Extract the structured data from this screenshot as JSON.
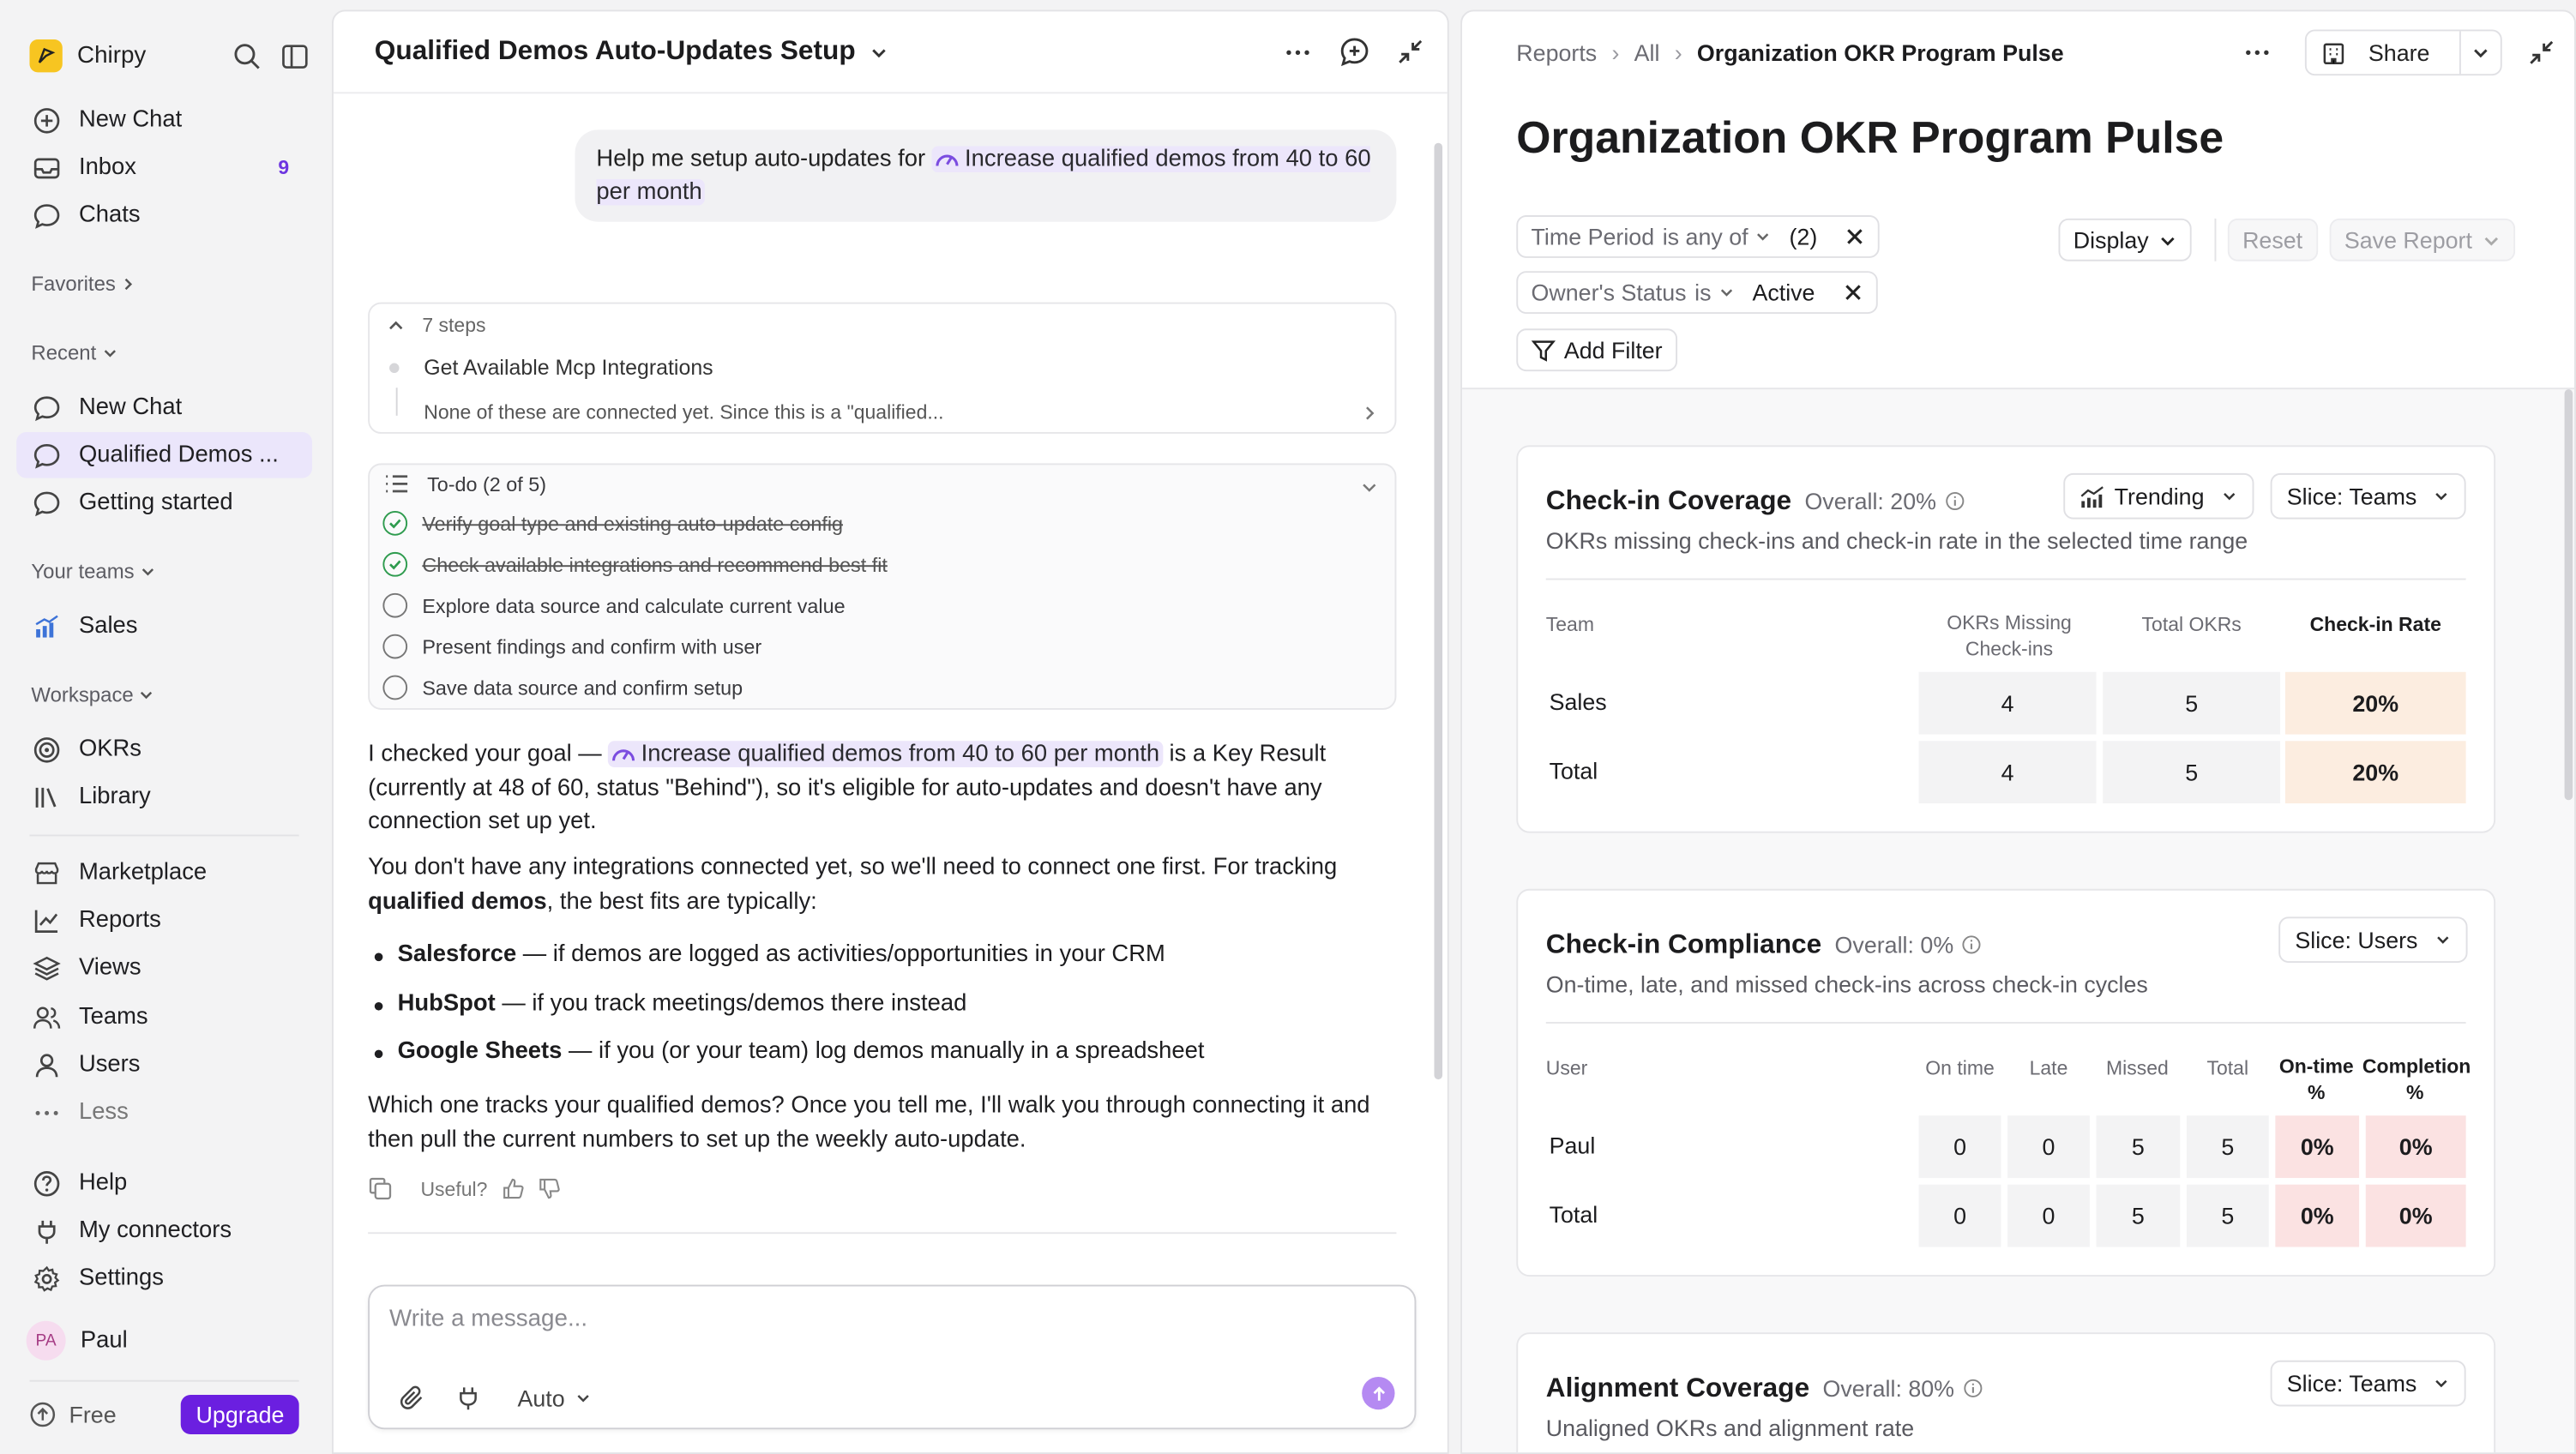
{
  "app": {
    "brand": "Chirpy"
  },
  "sidebar": {
    "top_items": [
      {
        "label": "New Chat",
        "icon": "plus-circle-icon"
      },
      {
        "label": "Inbox",
        "icon": "inbox-icon",
        "badge": "9"
      },
      {
        "label": "Chats",
        "icon": "chat-icon"
      }
    ],
    "favorites_title": "Favorites",
    "recent_title": "Recent",
    "recent_items": [
      "New Chat",
      "Qualified Demos ...",
      "Getting started"
    ],
    "teams_title": "Your teams",
    "team_items": [
      "Sales"
    ],
    "workspace_title": "Workspace",
    "workspace_items": [
      "OKRs",
      "Library"
    ],
    "more_items": [
      "Marketplace",
      "Reports",
      "Views",
      "Teams",
      "Users",
      "Less"
    ],
    "bottom_items": [
      "Help",
      "My connectors",
      "Settings"
    ],
    "user": {
      "initials": "PA",
      "name": "Paul"
    },
    "plan": "Free",
    "upgrade_label": "Upgrade"
  },
  "chat": {
    "title": "Qualified Demos Auto-Updates Setup",
    "user_message": {
      "prefix": "Help me setup auto-updates for ",
      "goal": "Increase qualified demos from 40 to 60 per month"
    },
    "steps": {
      "count_label": "7 steps",
      "step_title": "Get Available Mcp Integrations",
      "step_detail": "None of these are connected yet. Since this is a \"qualified..."
    },
    "todo": {
      "title": "To-do (2 of 5)",
      "items": [
        {
          "text": "Verify goal type and existing auto-update config",
          "done": true
        },
        {
          "text": "Check available integrations and recommend best fit",
          "done": true
        },
        {
          "text": "Explore data source and calculate current value",
          "done": false
        },
        {
          "text": "Present findings and confirm with user",
          "done": false
        },
        {
          "text": "Save data source and confirm setup",
          "done": false
        }
      ]
    },
    "reply": {
      "p1_start": "I checked your goal — ",
      "p1_goal": "Increase qualified demos from 40 to 60 per month",
      "p1_end": " is a Key Result (currently at 48 of 60, status \"Behind\"), so it's eligible for auto-updates and doesn't have any connection set up yet.",
      "p2_start": "You don't have any integrations connected yet, so we'll need to connect one first. For tracking ",
      "p2_bold": "qualified demos",
      "p2_end": ", the best fits are typically:",
      "bullets": [
        {
          "name": "Salesforce",
          "text": " — if demos are logged as activities/opportunities in your CRM"
        },
        {
          "name": "HubSpot",
          "text": " — if you track meetings/demos there instead"
        },
        {
          "name": "Google Sheets",
          "text": " — if you (or your team) log demos manually in a spreadsheet"
        }
      ],
      "p3": "Which one tracks your qualified demos? Once you tell me, I'll walk you through connecting it and then pull the current numbers to set up the weekly auto-update."
    },
    "useful_label": "Useful?",
    "composer": {
      "placeholder": "Write a message...",
      "mode": "Auto"
    }
  },
  "report": {
    "breadcrumb": [
      "Reports",
      "All",
      "Organization OKR Program Pulse"
    ],
    "share_label": "Share",
    "title": "Organization OKR Program Pulse",
    "filters": [
      {
        "field": "Time Period",
        "op": "is any of",
        "value": "(2)"
      },
      {
        "field": "Owner's Status",
        "op": "is",
        "value": "Active"
      }
    ],
    "add_filter": "Add Filter",
    "display_label": "Display",
    "reset_label": "Reset",
    "save_label": "Save Report",
    "sections": [
      {
        "name": "Check-in Coverage",
        "overall": "Overall: 20%",
        "desc": "OKRs missing check-ins and check-in rate in the selected time range",
        "view": "Trending",
        "slice": "Slice: Teams",
        "headers": [
          "Team",
          "OKRs Missing Check-ins",
          "Total OKRs",
          "Check-in Rate"
        ],
        "rows": [
          {
            "label": "Sales",
            "cells": [
              "4",
              "5",
              "20%"
            ]
          },
          {
            "label": "Total",
            "cells": [
              "4",
              "5",
              "20%"
            ]
          }
        ]
      },
      {
        "name": "Check-in Compliance",
        "overall": "Overall: 0%",
        "desc": "On-time, late, and missed check-ins across check-in cycles",
        "slice": "Slice: Users",
        "headers": [
          "User",
          "On time",
          "Late",
          "Missed",
          "Total",
          "On-time %",
          "Completion %"
        ],
        "rows": [
          {
            "label": "Paul",
            "cells": [
              "0",
              "0",
              "5",
              "5",
              "0%",
              "0%"
            ]
          },
          {
            "label": "Total",
            "cells": [
              "0",
              "0",
              "5",
              "5",
              "0%",
              "0%"
            ]
          }
        ]
      },
      {
        "name": "Alignment Coverage",
        "overall": "Overall: 80%",
        "desc": "Unaligned OKRs and alignment rate",
        "slice": "Slice: Teams"
      }
    ]
  },
  "colors": {
    "accent": "#6b1fe0",
    "active_nav": "#ebe6fb",
    "warm_cell": "#fcede0",
    "red_cell": "#fbe2e2",
    "done_check": "#2e9b4e"
  }
}
